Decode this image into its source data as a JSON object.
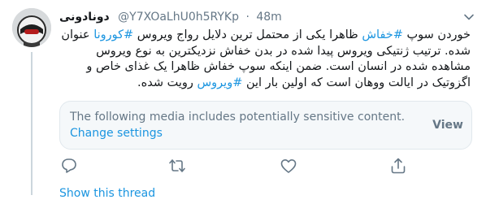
{
  "tweet": {
    "display_name": "دونادونی",
    "handle": "@Y7XOaLhU0h5RYKp",
    "separator": "·",
    "time": "48m",
    "body_before_hashtag1": "خوردن سوپ ",
    "hashtag1": "#خفاش",
    "body_mid1": " ظاهرا یکی از محتمل ترین دلایل رواج ویروس ",
    "hashtag2": "#کورونا",
    "body_mid2": " عنوان شده. ترتیب ژنتیکی ویروس پیدا شده در بدن خفاش نزدیکترین به نوع ویروس مشاهده شده در انسان است. ضمن اینکه سوپ خفاش ظاهرا یک غذای خاص و اگزوتیک در ایالت ووهان است که اولین بار این ",
    "hashtag3": "#ویروس",
    "body_end": " رویت شده.",
    "sensitive_media_message": "The following media includes potentially sensitive content.",
    "change_settings_link": "Change settings",
    "view_button": "View",
    "show_thread_link": "Show this thread"
  },
  "icons": {
    "caret": "chevron-down-icon",
    "reply": "reply-icon",
    "retweet": "retweet-icon",
    "like": "heart-icon",
    "share": "share-icon"
  },
  "colors": {
    "link": "#1b95e0",
    "muted": "#657786",
    "card_bg": "#f5f8fa",
    "thread_line": "#ccd6dd"
  }
}
